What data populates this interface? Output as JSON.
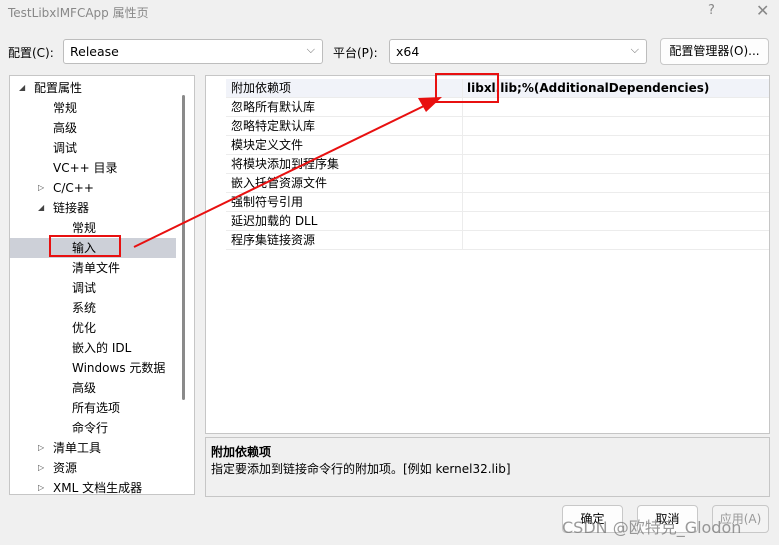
{
  "window": {
    "title": "TestLibxlMFCApp 属性页",
    "help": "?",
    "close": "✕"
  },
  "config": {
    "label": "配置(C):",
    "value": "Release",
    "platform_label": "平台(P):",
    "platform_value": "x64",
    "manager_button": "配置管理器(O)..."
  },
  "tree": [
    {
      "label": "配置属性",
      "level": 0,
      "arrow": "expanded"
    },
    {
      "label": "常规",
      "level": 1
    },
    {
      "label": "高级",
      "level": 1
    },
    {
      "label": "调试",
      "level": 1
    },
    {
      "label": "VC++ 目录",
      "level": 1
    },
    {
      "label": "C/C++",
      "level": 1,
      "arrow": "collapsed"
    },
    {
      "label": "链接器",
      "level": 1,
      "arrow": "expanded"
    },
    {
      "label": "常规",
      "level": 2
    },
    {
      "label": "输入",
      "level": 2,
      "selected": true
    },
    {
      "label": "清单文件",
      "level": 2
    },
    {
      "label": "调试",
      "level": 2
    },
    {
      "label": "系统",
      "level": 2
    },
    {
      "label": "优化",
      "level": 2
    },
    {
      "label": "嵌入的 IDL",
      "level": 2
    },
    {
      "label": "Windows 元数据",
      "level": 2
    },
    {
      "label": "高级",
      "level": 2
    },
    {
      "label": "所有选项",
      "level": 2
    },
    {
      "label": "命令行",
      "level": 2
    },
    {
      "label": "清单工具",
      "level": 1,
      "arrow": "collapsed"
    },
    {
      "label": "资源",
      "level": 1,
      "arrow": "collapsed"
    },
    {
      "label": "XML 文档生成器",
      "level": 1,
      "arrow": "collapsed"
    }
  ],
  "properties": [
    {
      "name": "附加依赖项",
      "value": "libxl.lib;%(AdditionalDependencies)"
    },
    {
      "name": "忽略所有默认库",
      "value": ""
    },
    {
      "name": "忽略特定默认库",
      "value": ""
    },
    {
      "name": "模块定义文件",
      "value": ""
    },
    {
      "name": "将模块添加到程序集",
      "value": ""
    },
    {
      "name": "嵌入托管资源文件",
      "value": ""
    },
    {
      "name": "强制符号引用",
      "value": ""
    },
    {
      "name": "延迟加载的 DLL",
      "value": ""
    },
    {
      "name": "程序集链接资源",
      "value": ""
    }
  ],
  "description": {
    "title": "附加依赖项",
    "text": "指定要添加到链接命令行的附加项。[例如 kernel32.lib]"
  },
  "buttons": {
    "ok": "确定",
    "cancel": "取消",
    "apply": "应用(A)"
  },
  "watermark": "CSDN @欧特克_Glodon",
  "annotation_color": "#e81010"
}
